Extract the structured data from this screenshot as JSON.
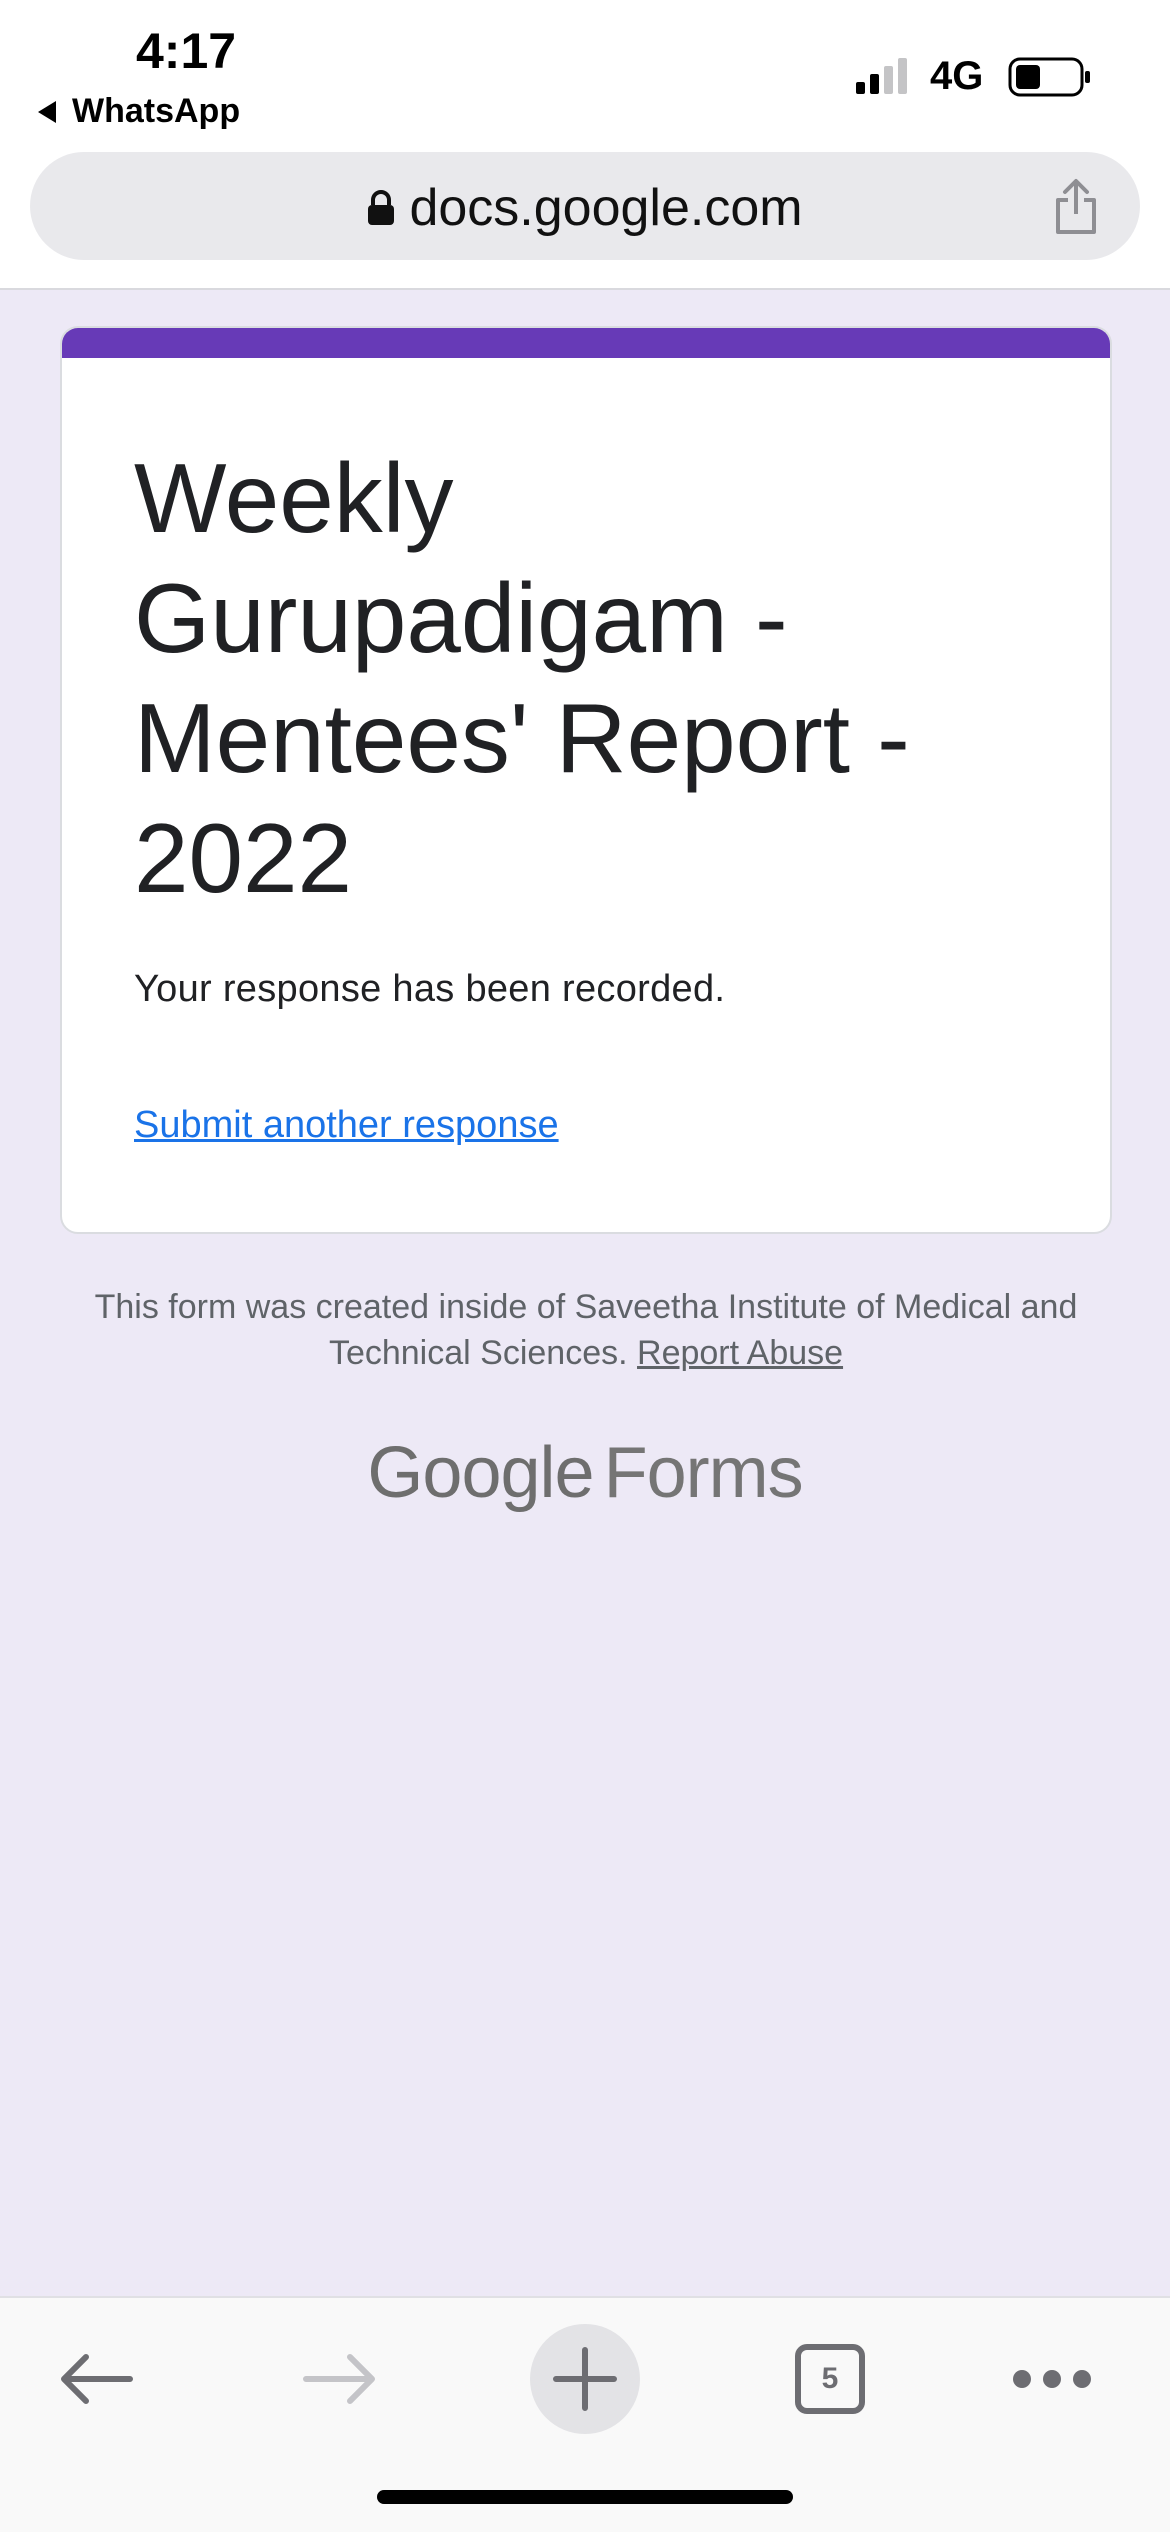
{
  "status_bar": {
    "time": "4:17",
    "back_app": "WhatsApp",
    "network": "4G",
    "icons": [
      "signal-icon",
      "battery-icon"
    ]
  },
  "browser": {
    "url": "docs.google.com",
    "icons": [
      "lock-icon",
      "share-icon"
    ],
    "toolbar": {
      "tab_count": "5",
      "icons": [
        "back-arrow-icon",
        "forward-arrow-icon",
        "plus-icon",
        "tabs-icon",
        "more-icon"
      ]
    }
  },
  "form": {
    "title": "Weekly Gurupadigam - Mentees' Report - 2022",
    "message": "Your response has been recorded.",
    "submit_another_link": "Submit another response",
    "accent_color": "#673ab7"
  },
  "footer": {
    "note": "This form was created inside of Saveetha Institute of Medical and Technical Sciences.",
    "report_abuse": "Report Abuse",
    "brand_google": "Google",
    "brand_forms": "Forms"
  }
}
